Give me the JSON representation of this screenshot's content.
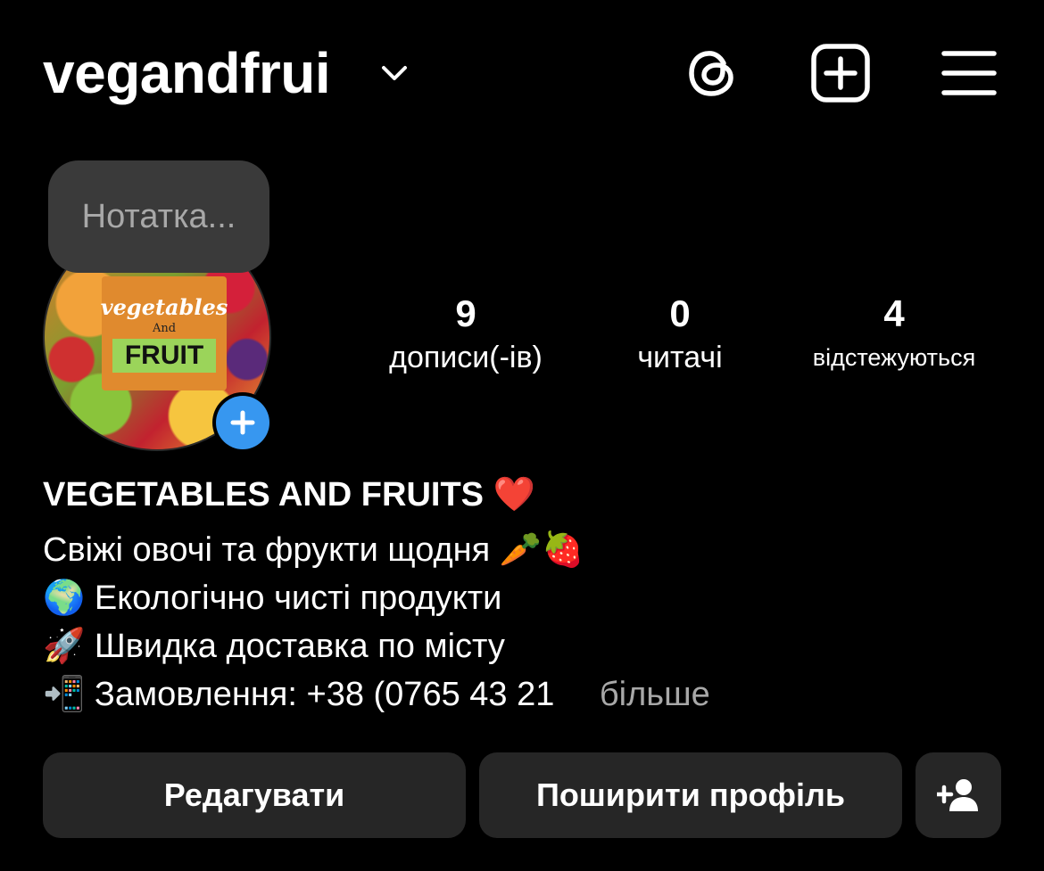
{
  "header": {
    "username": "vegandfrui"
  },
  "note": {
    "placeholder": "Нотатка..."
  },
  "avatar": {
    "line1": "vegetables",
    "line2": "And",
    "line3": "FRUIT"
  },
  "stats": [
    {
      "value": "9",
      "label": "дописи(-ів)"
    },
    {
      "value": "0",
      "label": "читачі"
    },
    {
      "value": "4",
      "label": "відстежуються"
    }
  ],
  "bio": {
    "name": "VEGETABLES AND FRUITS ❤️",
    "lines": [
      "Свіжі овочі та фрукти щодня 🥕🍓",
      "🌍 Екологічно чисті продукти",
      "🚀 Швидка доставка по місту",
      "📲 Замовлення: +38 (0765 43 21"
    ],
    "more": "більше"
  },
  "buttons": {
    "edit": "Редагувати",
    "share": "Поширити профіль"
  },
  "colors": {
    "background": "#000000",
    "button": "#262626",
    "accent": "#3797f0",
    "muted": "#a8a8a8"
  }
}
